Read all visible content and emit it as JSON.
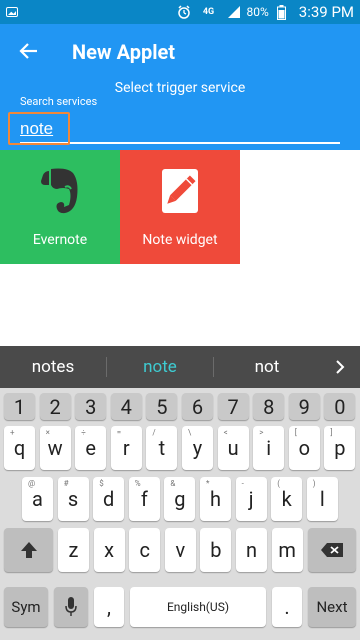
{
  "status_bar": {
    "network": "4G",
    "battery": "80%",
    "time": "3:39 PM"
  },
  "header": {
    "title": "New Applet",
    "subtitle": "Select trigger service",
    "search_label": "Search services",
    "search_value": "note"
  },
  "services": [
    {
      "label": "Evernote",
      "color": "#2dbe60",
      "icon": "evernote-elephant-icon"
    },
    {
      "label": "Note widget",
      "color": "#ef4a3a",
      "icon": "pencil-note-icon"
    }
  ],
  "suggestions": [
    "notes",
    "note",
    "not"
  ],
  "keyboard": {
    "numbers": [
      "1",
      "2",
      "3",
      "4",
      "5",
      "6",
      "7",
      "8",
      "9",
      "0"
    ],
    "row1": [
      "q",
      "w",
      "e",
      "r",
      "t",
      "y",
      "u",
      "i",
      "o",
      "p"
    ],
    "row1_sub": [
      "+",
      "×",
      "÷",
      "=",
      "/",
      "\\",
      "<",
      ">",
      "[",
      "]"
    ],
    "row2": [
      "a",
      "s",
      "d",
      "f",
      "g",
      "h",
      "j",
      "k",
      "l"
    ],
    "row2_sub": [
      "@",
      "#",
      "$",
      "%",
      "&",
      "*",
      "-",
      "(",
      ")"
    ],
    "row3": [
      "z",
      "x",
      "c",
      "v",
      "b",
      "n",
      "m"
    ],
    "row3_sub": [
      "",
      "",
      "",
      "",
      "",
      "",
      ""
    ],
    "sym_label": "Sym",
    "comma": ",",
    "space_label": "English(US)",
    "period": ".",
    "next_label": "Next"
  }
}
